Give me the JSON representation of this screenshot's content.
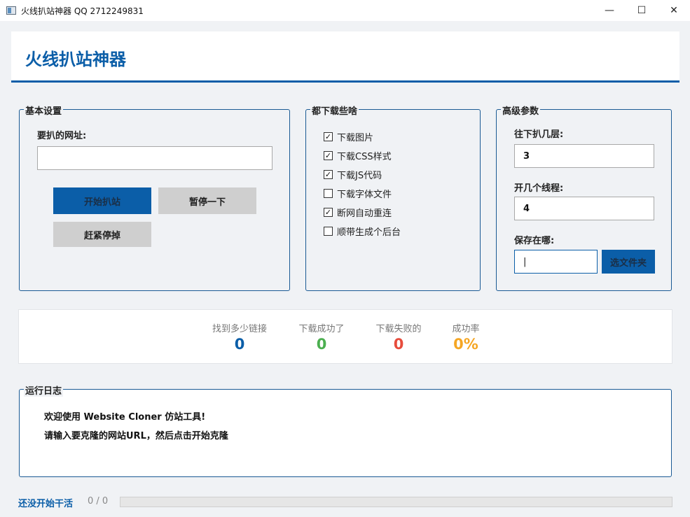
{
  "window": {
    "title": "火线扒站神器 QQ 2712249831",
    "minimize_glyph": "—",
    "maximize_glyph": "☐",
    "close_glyph": "✕"
  },
  "header": {
    "title": "火线扒站神器"
  },
  "basic": {
    "group_title": "基本设置",
    "url_label": "要扒的网址:",
    "url_value": "",
    "start_button": "开始扒站",
    "pause_button": "暂停一下",
    "stop_button": "赶紧停掉"
  },
  "download": {
    "group_title": "都下载些啥",
    "options": [
      {
        "label": "下载图片",
        "checked": true
      },
      {
        "label": "下载CSS样式",
        "checked": true
      },
      {
        "label": "下载JS代码",
        "checked": true
      },
      {
        "label": "下载字体文件",
        "checked": false
      },
      {
        "label": "断网自动重连",
        "checked": true
      },
      {
        "label": "顺带生成个后台",
        "checked": false
      }
    ]
  },
  "advanced": {
    "group_title": "高级参数",
    "depth_label": "往下扒几层:",
    "depth_value": "3",
    "threads_label": "开几个线程:",
    "threads_value": "4",
    "save_label": "保存在哪:",
    "save_value": "|",
    "browse_button": "选文件夹"
  },
  "stats": [
    {
      "label": "找到多少链接",
      "value": "0",
      "color": "#0b5ea8"
    },
    {
      "label": "下载成功了",
      "value": "0",
      "color": "#4caf50"
    },
    {
      "label": "下载失败的",
      "value": "0",
      "color": "#e74c3c"
    },
    {
      "label": "成功率",
      "value": "0%",
      "color": "#f5a623"
    }
  ],
  "log": {
    "group_title": "运行日志",
    "lines": [
      "欢迎使用 Website Cloner 仿站工具!",
      "请输入要克隆的网站URL，然后点击开始克隆"
    ]
  },
  "footer": {
    "status": "还没开始干活",
    "progress_text": "0 / 0",
    "progress_value": 0
  }
}
